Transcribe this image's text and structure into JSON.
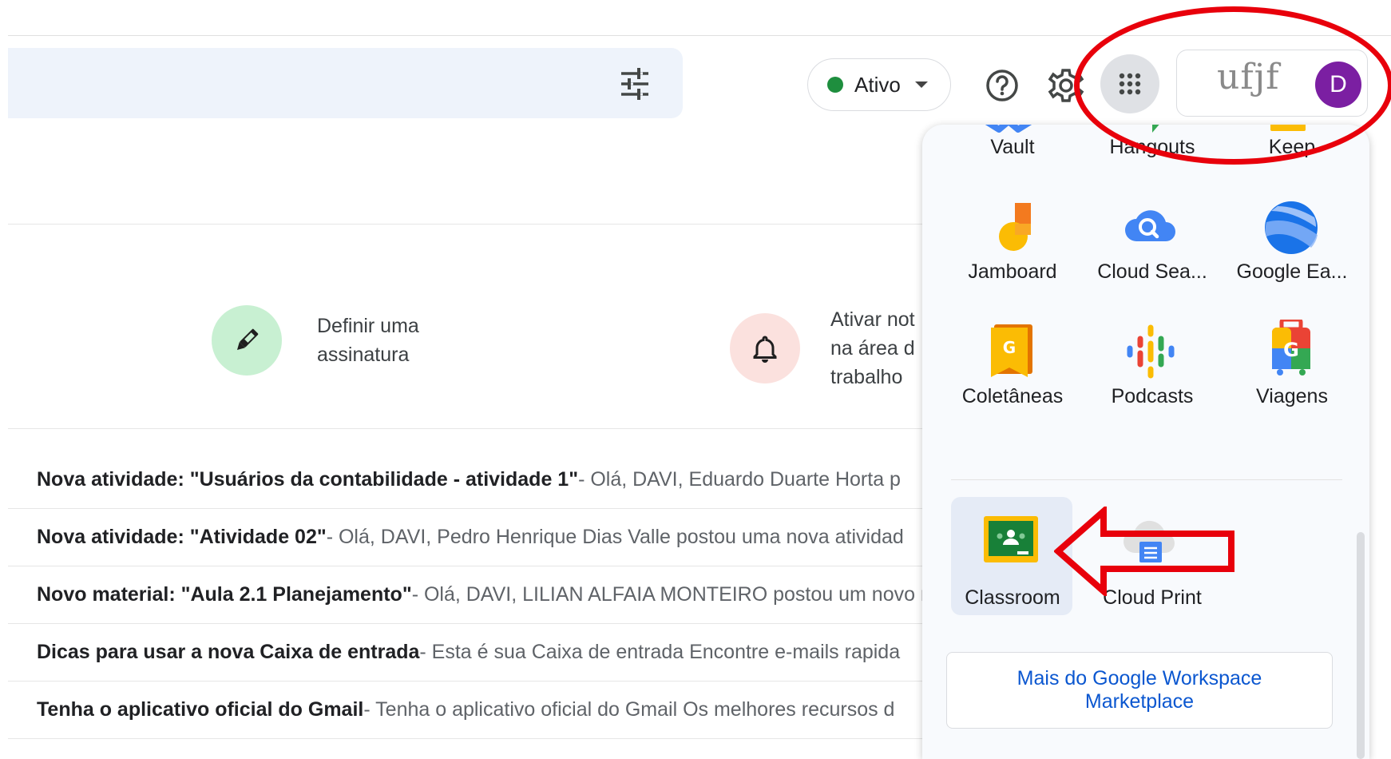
{
  "header": {
    "status_label": "Ativo",
    "org_logo_text": "ufjf",
    "avatar_initial": "D",
    "status_color": "#1e8e3e",
    "avatar_color": "#7b1fa2"
  },
  "tips": [
    {
      "icon": "pen-icon",
      "text": "Definir uma\nassinatura",
      "color": "#c8f0d2"
    },
    {
      "icon": "bell-icon",
      "text": "Ativar not\nna área d\ntrabalho",
      "color": "#fbe1de"
    }
  ],
  "emails": [
    {
      "subject": "Nova atividade: \"Usuários da contabilidade - atividade 1\"",
      "snippet": " - Olá, DAVI, Eduardo Duarte Horta p"
    },
    {
      "subject": "Nova atividade: \"Atividade 02\"",
      "snippet": " - Olá, DAVI, Pedro Henrique Dias Valle postou uma nova atividad"
    },
    {
      "subject": "Novo material: \"Aula 2.1 Planejamento\"",
      "snippet": " - Olá, DAVI, LILIAN ALFAIA MONTEIRO postou um novo m"
    },
    {
      "subject": "Dicas para usar a nova Caixa de entrada",
      "snippet": " - Esta é sua Caixa de entrada Encontre e-mails rapida"
    },
    {
      "subject": "Tenha o aplicativo oficial do Gmail",
      "snippet": " - Tenha o aplicativo oficial do Gmail Os melhores recursos d"
    }
  ],
  "apps_panel": {
    "apps": [
      {
        "label": "Vault",
        "icon": "vault-icon"
      },
      {
        "label": "Hangouts",
        "icon": "hangouts-icon"
      },
      {
        "label": "Keep",
        "icon": "keep-icon"
      },
      {
        "label": "Jamboard",
        "icon": "jamboard-icon"
      },
      {
        "label": "Cloud Sea...",
        "icon": "cloud-search-icon"
      },
      {
        "label": "Google Ea...",
        "icon": "google-earth-icon"
      },
      {
        "label": "Coletâneas",
        "icon": "collections-icon"
      },
      {
        "label": "Podcasts",
        "icon": "podcasts-icon"
      },
      {
        "label": "Viagens",
        "icon": "travel-icon"
      },
      {
        "label": "Classroom",
        "icon": "classroom-icon"
      },
      {
        "label": "Cloud Print",
        "icon": "cloud-print-icon"
      }
    ],
    "marketplace_label": "Mais do Google Workspace Marketplace"
  },
  "annotations": {
    "highlight_color": "#e8000b"
  }
}
